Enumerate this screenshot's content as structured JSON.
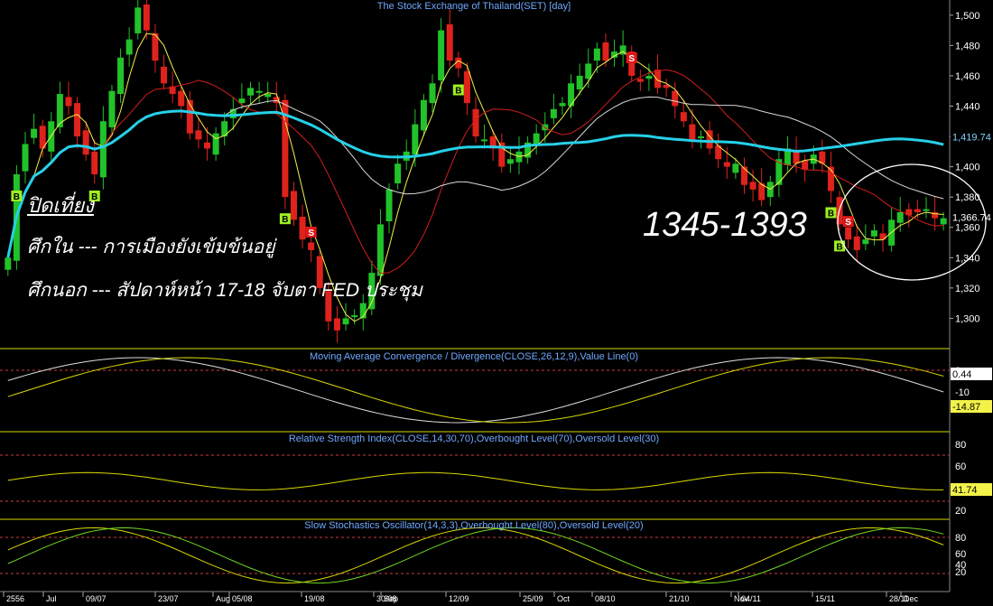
{
  "chart_data": {
    "type": "candlestick",
    "title": "The Stock Exchange of Thailand(SET) [day]",
    "price_axis": {
      "ylim": [
        1280,
        1510
      ],
      "ticks": [
        1300,
        1320,
        1340,
        1360,
        1380,
        1400,
        1420,
        1440,
        1460,
        1480,
        1500
      ],
      "last_price_label": "1,366.74",
      "ma_label": "1,419.74"
    },
    "x_labels": [
      "2556",
      "Jul",
      "09/07",
      "23/07",
      "Aug",
      "05/08",
      "19/08",
      "Sep",
      "30/08",
      "12/09",
      "25/09",
      "Oct",
      "08/10",
      "21/10",
      "Nov",
      "04/11",
      "15/11",
      "28/11",
      "Dec"
    ],
    "closes": [
      1340,
      1395,
      1415,
      1425,
      1412,
      1430,
      1448,
      1440,
      1420,
      1408,
      1395,
      1430,
      1450,
      1472,
      1484,
      1505,
      1490,
      1470,
      1455,
      1448,
      1440,
      1422,
      1418,
      1412,
      1422,
      1430,
      1438,
      1445,
      1452,
      1450,
      1448,
      1442,
      1380,
      1365,
      1352,
      1345,
      1320,
      1298,
      1292,
      1300,
      1302,
      1310,
      1330,
      1362,
      1385,
      1402,
      1410,
      1428,
      1444,
      1455,
      1490,
      1470,
      1465,
      1442,
      1420,
      1418,
      1412,
      1400,
      1405,
      1410,
      1416,
      1422,
      1428,
      1438,
      1442,
      1455,
      1460,
      1468,
      1478,
      1470,
      1476,
      1480,
      1460,
      1456,
      1460,
      1452,
      1452,
      1440,
      1430,
      1418,
      1420,
      1412,
      1405,
      1400,
      1402,
      1388,
      1385,
      1378,
      1390,
      1405,
      1412,
      1402,
      1398,
      1408,
      1402,
      1384,
      1362,
      1352,
      1345,
      1352,
      1358,
      1352,
      1365,
      1370,
      1368,
      1370,
      1372,
      1366,
      1366
    ],
    "signals": [
      {
        "label": "B",
        "type": "buy"
      },
      {
        "label": "B",
        "type": "buy"
      },
      {
        "label": "S",
        "type": "sell"
      },
      {
        "label": "B",
        "type": "buy"
      },
      {
        "label": "B",
        "type": "buy"
      },
      {
        "label": "S",
        "type": "sell"
      },
      {
        "label": "S",
        "type": "sell"
      },
      {
        "label": "B",
        "type": "buy"
      },
      {
        "label": "B",
        "type": "buy"
      }
    ],
    "macd": {
      "title": "Moving Average Convergence / Divergence(CLOSE,26,12,9),Value Line(0)",
      "ticks": [
        "0",
        "-10"
      ],
      "value_labels": [
        "0.44",
        "-14.87"
      ]
    },
    "rsi": {
      "title": "Relative Strength Index(CLOSE,14,30,70),Overbought Level(70),Oversold Level(30)",
      "ticks": [
        "80",
        "60",
        "20"
      ],
      "value_label": "41.74"
    },
    "stoch": {
      "title": "Slow Stochastics Oscillator(14,3,3),Overbought Level(80),Oversold Level(20)",
      "ticks": [
        "80",
        "60",
        "40",
        "20"
      ]
    }
  },
  "annotations": {
    "title": "ปิดเที่ยง",
    "line1": "ศึกใน --- การเมืองยังเข้มข้นอยู่",
    "line2": "ศึกนอก --- สัปดาห์หน้า 17-18 จับตา FED ประชุม",
    "range": "1345-1393"
  },
  "colors": {
    "up": "#22c22a",
    "down": "#e0221c",
    "ma_long": "#26d0e8",
    "ma_mid": "#d8d8d8",
    "ma_short": "#d21d1d",
    "ma_fast": "#f2f24a",
    "divider": "#d8d800"
  }
}
